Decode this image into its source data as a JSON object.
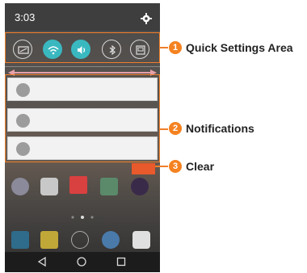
{
  "status": {
    "time": "3:03",
    "settings_icon": "gear-icon"
  },
  "quick_settings": [
    {
      "name": "screen-rotation-icon",
      "active": false
    },
    {
      "name": "wifi-icon",
      "active": true
    },
    {
      "name": "sound-icon",
      "active": true
    },
    {
      "name": "bluetooth-icon",
      "active": false
    },
    {
      "name": "qslide-icon",
      "active": false
    }
  ],
  "brightness_slider": {
    "icon": "double-arrow-icon"
  },
  "notifications": [
    {
      "text": ""
    },
    {
      "text": ""
    },
    {
      "text": ""
    }
  ],
  "callouts": [
    {
      "number": "1",
      "label": "Quick Settings Area"
    },
    {
      "number": "2",
      "label": "Notifications"
    },
    {
      "number": "3",
      "label": "Clear"
    }
  ],
  "colors": {
    "accent": "#f58220",
    "toggle_on": "#3ab8c0",
    "clear": "#e8592b"
  },
  "nav": {
    "back": "back-icon",
    "home": "home-icon",
    "recents": "recents-icon"
  }
}
